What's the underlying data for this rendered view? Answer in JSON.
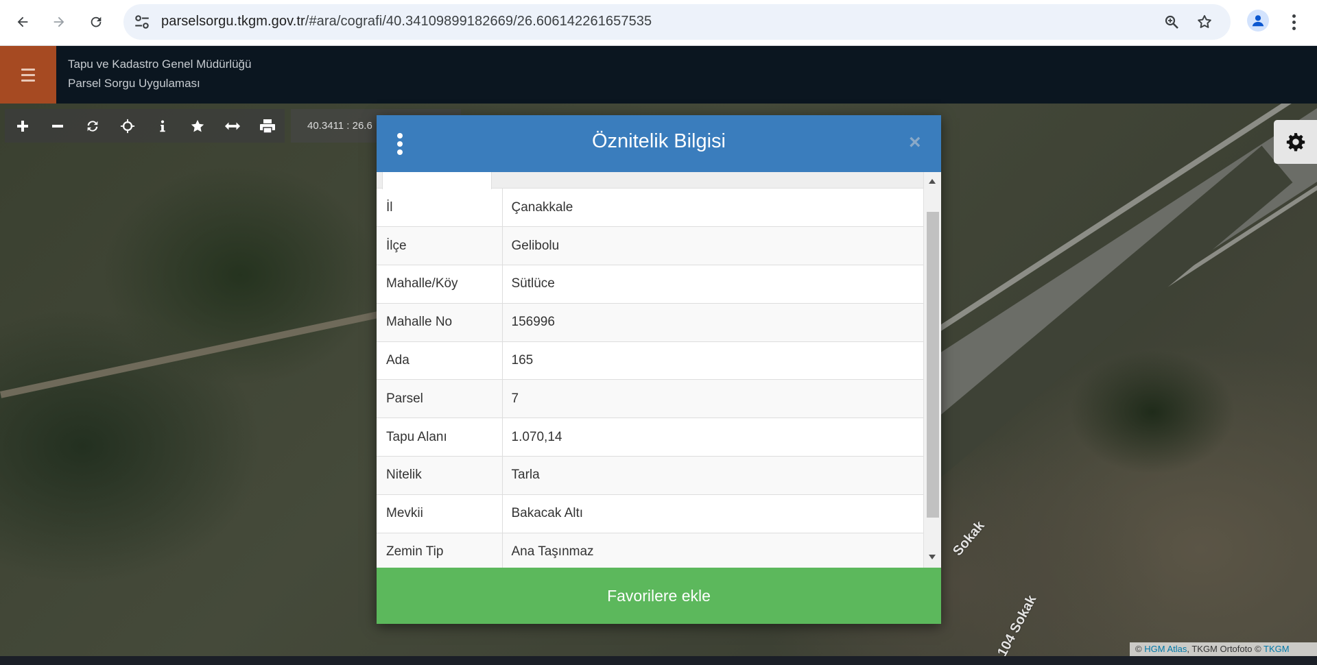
{
  "browser": {
    "url_host": "parselsorgu.tkgm.gov.tr",
    "url_path": "/#ara/cografi/40.34109899182669/26.606142261657535"
  },
  "app": {
    "org_name": "Tapu ve Kadastro Genel Müdürlüğü",
    "app_name": "Parsel Sorgu Uygulaması"
  },
  "map": {
    "coordinates": "40.3411 : 26.6",
    "street_label_1": "Sokak",
    "street_label_2": "104 Sokak",
    "attribution": {
      "copyright_1": "©",
      "link_1": "HGM Atlas",
      "middle": ", TKGM Ortofoto ©",
      "link_2": "TKGM"
    },
    "toolbar_icons": [
      "plus-icon",
      "minus-icon",
      "refresh-icon",
      "crosshair-icon",
      "info-icon",
      "star-icon",
      "measure-icon",
      "print-icon"
    ]
  },
  "modal": {
    "title": "Öznitelik Bilgisi",
    "close_label": "×",
    "footer_button": "Favorilere ekle",
    "rows": [
      {
        "key": "İl",
        "value": "Çanakkale"
      },
      {
        "key": "İlçe",
        "value": "Gelibolu"
      },
      {
        "key": "Mahalle/Köy",
        "value": "Sütlüce"
      },
      {
        "key": "Mahalle No",
        "value": "156996"
      },
      {
        "key": "Ada",
        "value": "165"
      },
      {
        "key": "Parsel",
        "value": "7"
      },
      {
        "key": "Tapu Alanı",
        "value": "1.070,14"
      },
      {
        "key": "Nitelik",
        "value": "Tarla"
      },
      {
        "key": "Mevkii",
        "value": "Bakacak Altı"
      },
      {
        "key": "Zemin Tip",
        "value": "Ana Taşınmaz"
      }
    ]
  },
  "colors": {
    "modal_header": "#3a7dbd",
    "footer_button": "#5cb85c",
    "hamburger_bg": "#a64a22",
    "app_header_bg": "#0b1620"
  }
}
